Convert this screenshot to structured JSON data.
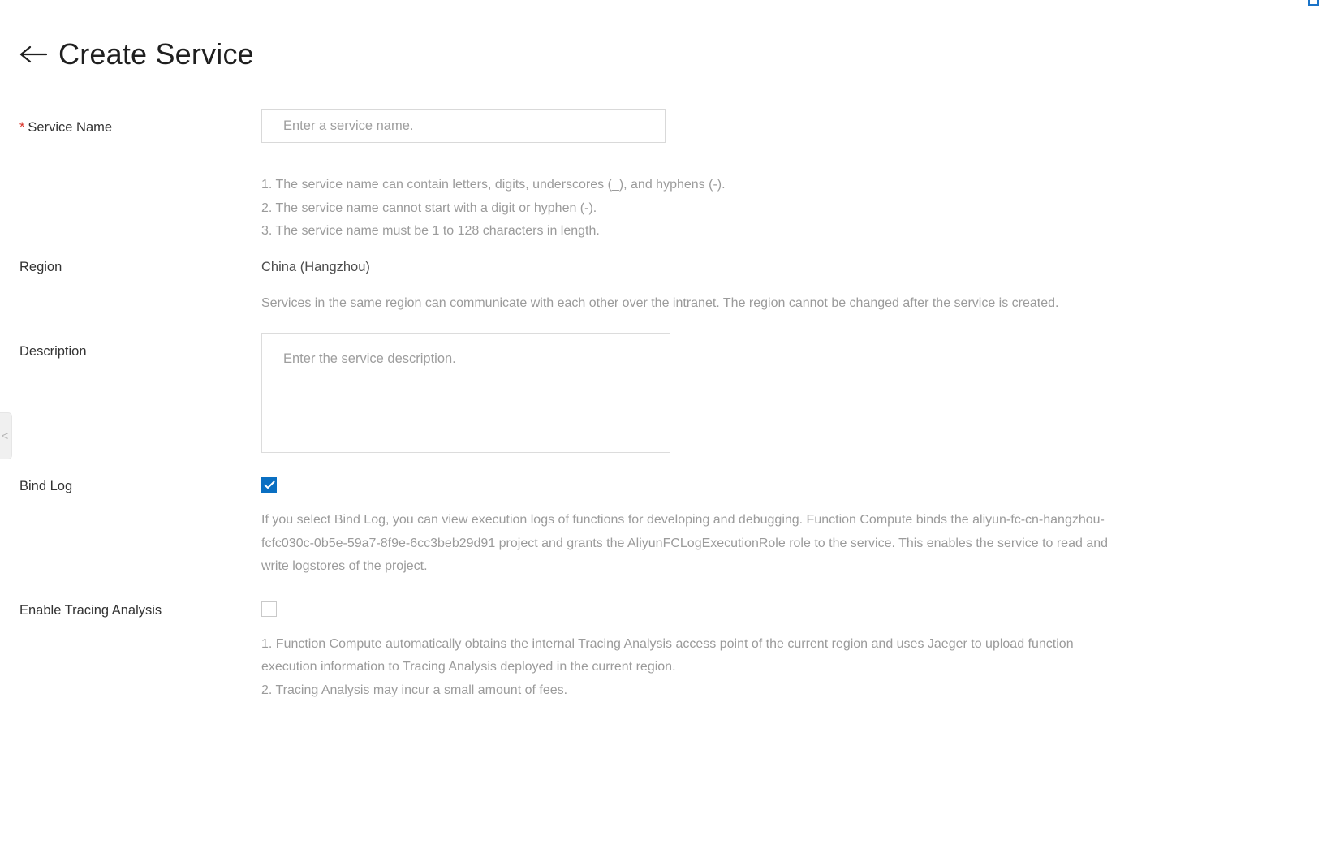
{
  "header": {
    "title": "Create Service",
    "back_icon": "arrow-left-icon"
  },
  "form": {
    "service_name": {
      "label": "Service Name",
      "required_marker": "*",
      "required": true,
      "value": "",
      "placeholder": "Enter a service name.",
      "help_lines": [
        "1. The service name can contain letters, digits, underscores (_), and hyphens (-).",
        "2. The service name cannot start with a digit or hyphen (-).",
        "3. The service name must be 1 to 128 characters in length."
      ]
    },
    "region": {
      "label": "Region",
      "value": "China (Hangzhou)",
      "help": "Services in the same region can communicate with each other over the intranet. The region cannot be changed after the service is created."
    },
    "description": {
      "label": "Description",
      "value": "",
      "placeholder": "Enter the service description."
    },
    "bind_log": {
      "label": "Bind Log",
      "checked": true,
      "help": "If you select Bind Log, you can view execution logs of functions for developing and debugging. Function Compute binds the aliyun-fc-cn-hangzhou-fcfc030c-0b5e-59a7-8f9e-6cc3beb29d91 project and grants the AliyunFCLogExecutionRole role to the service. This enables the service to read and write logstores of the project."
    },
    "tracing_analysis": {
      "label": "Enable Tracing Analysis",
      "checked": false,
      "help_lines": [
        "1. Function Compute automatically obtains the internal Tracing Analysis access point of the current region and uses Jaeger to upload function execution information to Tracing Analysis deployed in the current region.",
        "2. Tracing Analysis may incur a small amount of fees."
      ]
    }
  },
  "sidebar_toggle": {
    "icon": "chevron-left-icon",
    "label": "<"
  },
  "colors": {
    "accent": "#0a6fc2",
    "required_star": "#d93026",
    "help_text": "#9b9b9b",
    "label_text": "#333333",
    "border": "#d9d9d9"
  }
}
